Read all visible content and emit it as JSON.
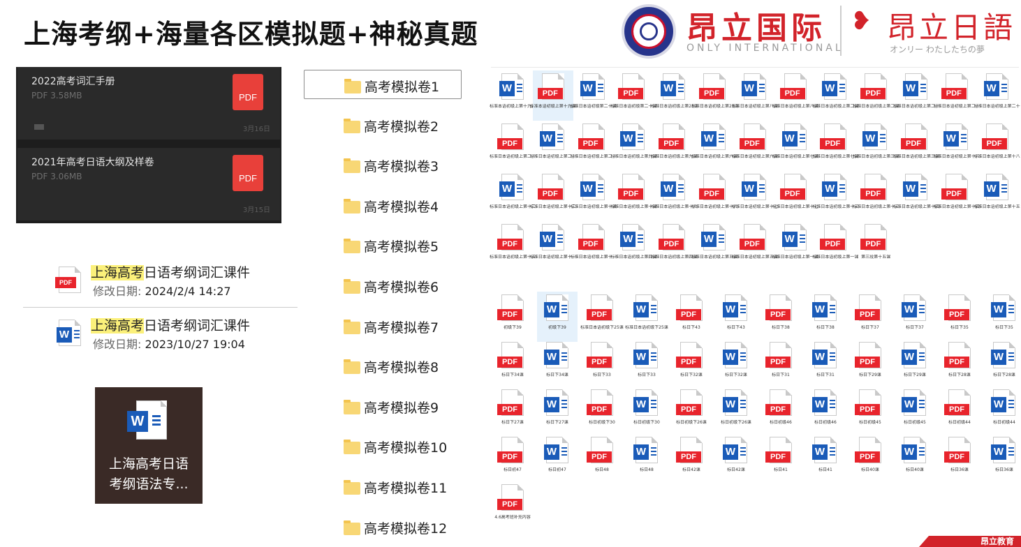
{
  "header": {
    "title": "上海考纲+海量各区模拟题+神秘真题",
    "badge_text": "ONLY",
    "brand_cn": "昂立国际",
    "brand_en": "ONLY INTERNATIONAL",
    "brand2_cn": "昂立日語",
    "brand2_tagline": "オンリー わたしたちの夢",
    "accent_color": "#d2232a",
    "badge_color": "#27348b"
  },
  "dark_panel": {
    "cards": [
      {
        "name": "2022高考词汇手册",
        "meta": "PDF 3.58MB",
        "date": "3月16日",
        "icon": "pdf-icon"
      },
      {
        "name": "2021年高考日语大纲及样卷",
        "meta": "PDF 3.06MB",
        "date": "3月15日",
        "icon": "pdf-icon"
      }
    ]
  },
  "search_results": [
    {
      "highlight": "上海高考",
      "rest": "日语考纲词汇课件",
      "date_label": "修改日期:",
      "date": "2024/2/4 14:27",
      "icon": "pdf-icon"
    },
    {
      "highlight": "上海高考",
      "rest": "日语考纲词汇课件",
      "date_label": "修改日期:",
      "date": "2023/10/27 19:04",
      "icon": "word-icon"
    }
  ],
  "thumbnail": {
    "line1": "上海高考日语",
    "line2": "考纲语法专...",
    "icon": "word-icon"
  },
  "folders": [
    "高考模拟卷1",
    "高考模拟卷2",
    "高考模拟卷3",
    "高考模拟卷4",
    "高考模拟卷5",
    "高考模拟卷6",
    "高考模拟卷7",
    "高考模拟卷8",
    "高考模拟卷9",
    "高考模拟卷10",
    "高考模拟卷11",
    "高考模拟卷12"
  ],
  "grid1": [
    {
      "t": "w",
      "c": "标准本语初级上第十九课"
    },
    {
      "t": "p",
      "c": "标准本语初级上第十九课"
    },
    {
      "t": "w",
      "c": "标准日本语初级第二十课"
    },
    {
      "t": "p",
      "c": "标准日本语初级第二十课"
    },
    {
      "t": "w",
      "c": "标准日本语初级上第23课"
    },
    {
      "t": "p",
      "c": "标准日本语初级上第23课"
    },
    {
      "t": "w",
      "c": "标准日本语初级上第八课"
    },
    {
      "t": "p",
      "c": "标准日本语初级上第八课"
    },
    {
      "t": "w",
      "c": "标准日本语初级上第二课"
    },
    {
      "t": "p",
      "c": "标准日本语初级上第二课"
    },
    {
      "t": "w",
      "c": "标准日本语初级上第二十二课"
    },
    {
      "t": "p",
      "c": "标准日本语初级上第二十二课"
    },
    {
      "t": "w",
      "c": "标准日本语初级上第二十四课"
    },
    {
      "t": "p",
      "c": "标准日本语初级上第二十四课"
    },
    {
      "t": "w",
      "c": "标准日本语初级上第二十一课"
    },
    {
      "t": "p",
      "c": "标准日本语初级上第二十一课"
    },
    {
      "t": "w",
      "c": "标准日本语初级上第九课"
    },
    {
      "t": "p",
      "c": "标准日本语初级上第九课"
    },
    {
      "t": "w",
      "c": "标准日本语初级上第六课"
    },
    {
      "t": "p",
      "c": "标准日本语初级上第六课"
    },
    {
      "t": "w",
      "c": "标准日本语初级上第七课"
    },
    {
      "t": "p",
      "c": "标准日本语初级上第七课"
    },
    {
      "t": "w",
      "c": "标准日本语初级上第三课"
    },
    {
      "t": "p",
      "c": "标准日本语初级上第三课"
    },
    {
      "t": "w",
      "c": "标准日本语初级上第十八课"
    },
    {
      "t": "p",
      "c": "标准日本语初级上第十八课"
    },
    {
      "t": "w",
      "c": "标准日本语初级上第十二课"
    },
    {
      "t": "p",
      "c": "标准日本语初级上第十二课"
    },
    {
      "t": "w",
      "c": "标准日本语初级上第十课"
    },
    {
      "t": "p",
      "c": "标准日本语初级上第十课"
    },
    {
      "t": "w",
      "c": "标准日本语初级上第十六课"
    },
    {
      "t": "p",
      "c": "标准日本语初级上第十六课"
    },
    {
      "t": "w",
      "c": "标准日本语初级上第十七课"
    },
    {
      "t": "p",
      "c": "标准日本语初级上第十七课"
    },
    {
      "t": "w",
      "c": "标准日本语初级上第十三课"
    },
    {
      "t": "p",
      "c": "标准日本语初级上第十三课"
    },
    {
      "t": "w",
      "c": "标准日本语初级上第十四课"
    },
    {
      "t": "p",
      "c": "标准日本语初级上第十四课"
    },
    {
      "t": "w",
      "c": "标准日本语初级上第十五课"
    },
    {
      "t": "p",
      "c": "标准日本语初级上第十五课"
    },
    {
      "t": "w",
      "c": "标准日本语初级上第十一课"
    },
    {
      "t": "p",
      "c": "标准日本语初级上第十一课"
    },
    {
      "t": "w",
      "c": "标准日本语初级上第四课"
    },
    {
      "t": "p",
      "c": "标准日本语初级上第四课"
    },
    {
      "t": "w",
      "c": "标准日本语初级上第五课"
    },
    {
      "t": "p",
      "c": "标准日本语初级上第五课"
    },
    {
      "t": "w",
      "c": "标准日本语初级上第一课"
    },
    {
      "t": "p",
      "c": "标准日本语初级上第一课"
    },
    {
      "t": "p",
      "c": "第三段第十五课"
    }
  ],
  "grid2": [
    {
      "t": "p",
      "c": "初级下39"
    },
    {
      "t": "w",
      "c": "初级下39"
    },
    {
      "t": "p",
      "c": "标准日本语初级下25课"
    },
    {
      "t": "w",
      "c": "标准日本语初级下25课"
    },
    {
      "t": "p",
      "c": "标日下43"
    },
    {
      "t": "w",
      "c": "标日下43"
    },
    {
      "t": "p",
      "c": "标日下38"
    },
    {
      "t": "w",
      "c": "标日下38"
    },
    {
      "t": "p",
      "c": "标日下37"
    },
    {
      "t": "w",
      "c": "标日下37"
    },
    {
      "t": "p",
      "c": "标日下35"
    },
    {
      "t": "w",
      "c": "标日下35"
    },
    {
      "t": "p",
      "c": "标日下34课"
    },
    {
      "t": "w",
      "c": "标日下34课"
    },
    {
      "t": "p",
      "c": "标日下33"
    },
    {
      "t": "w",
      "c": "标日下33"
    },
    {
      "t": "p",
      "c": "标日下32课"
    },
    {
      "t": "w",
      "c": "标日下32课"
    },
    {
      "t": "p",
      "c": "标日下31"
    },
    {
      "t": "w",
      "c": "标日下31"
    },
    {
      "t": "p",
      "c": "标日下29课"
    },
    {
      "t": "w",
      "c": "标日下29课"
    },
    {
      "t": "p",
      "c": "标日下28课"
    },
    {
      "t": "w",
      "c": "标日下28课"
    },
    {
      "t": "p",
      "c": "标日下27课"
    },
    {
      "t": "w",
      "c": "标日下27课"
    },
    {
      "t": "p",
      "c": "标日初级下30"
    },
    {
      "t": "w",
      "c": "标日初级下30"
    },
    {
      "t": "p",
      "c": "标日初级下26课"
    },
    {
      "t": "w",
      "c": "标日初级下26课"
    },
    {
      "t": "p",
      "c": "标日初级46"
    },
    {
      "t": "w",
      "c": "标日初级46"
    },
    {
      "t": "p",
      "c": "标日初级45"
    },
    {
      "t": "w",
      "c": "标日初级45"
    },
    {
      "t": "p",
      "c": "标日初级44"
    },
    {
      "t": "w",
      "c": "标日初级44"
    },
    {
      "t": "p",
      "c": "标日初47"
    },
    {
      "t": "w",
      "c": "标日初47"
    },
    {
      "t": "p",
      "c": "标日48"
    },
    {
      "t": "w",
      "c": "标日48"
    },
    {
      "t": "p",
      "c": "标日42课"
    },
    {
      "t": "w",
      "c": "标日42课"
    },
    {
      "t": "p",
      "c": "标日41"
    },
    {
      "t": "w",
      "c": "标日41"
    },
    {
      "t": "p",
      "c": "标日40课"
    },
    {
      "t": "w",
      "c": "标日40课"
    },
    {
      "t": "p",
      "c": "标日36课"
    },
    {
      "t": "w",
      "c": "标日36课"
    },
    {
      "t": "p",
      "c": "4.6高考班补充内容"
    }
  ],
  "footer": {
    "corner_text": "昂立教育"
  }
}
